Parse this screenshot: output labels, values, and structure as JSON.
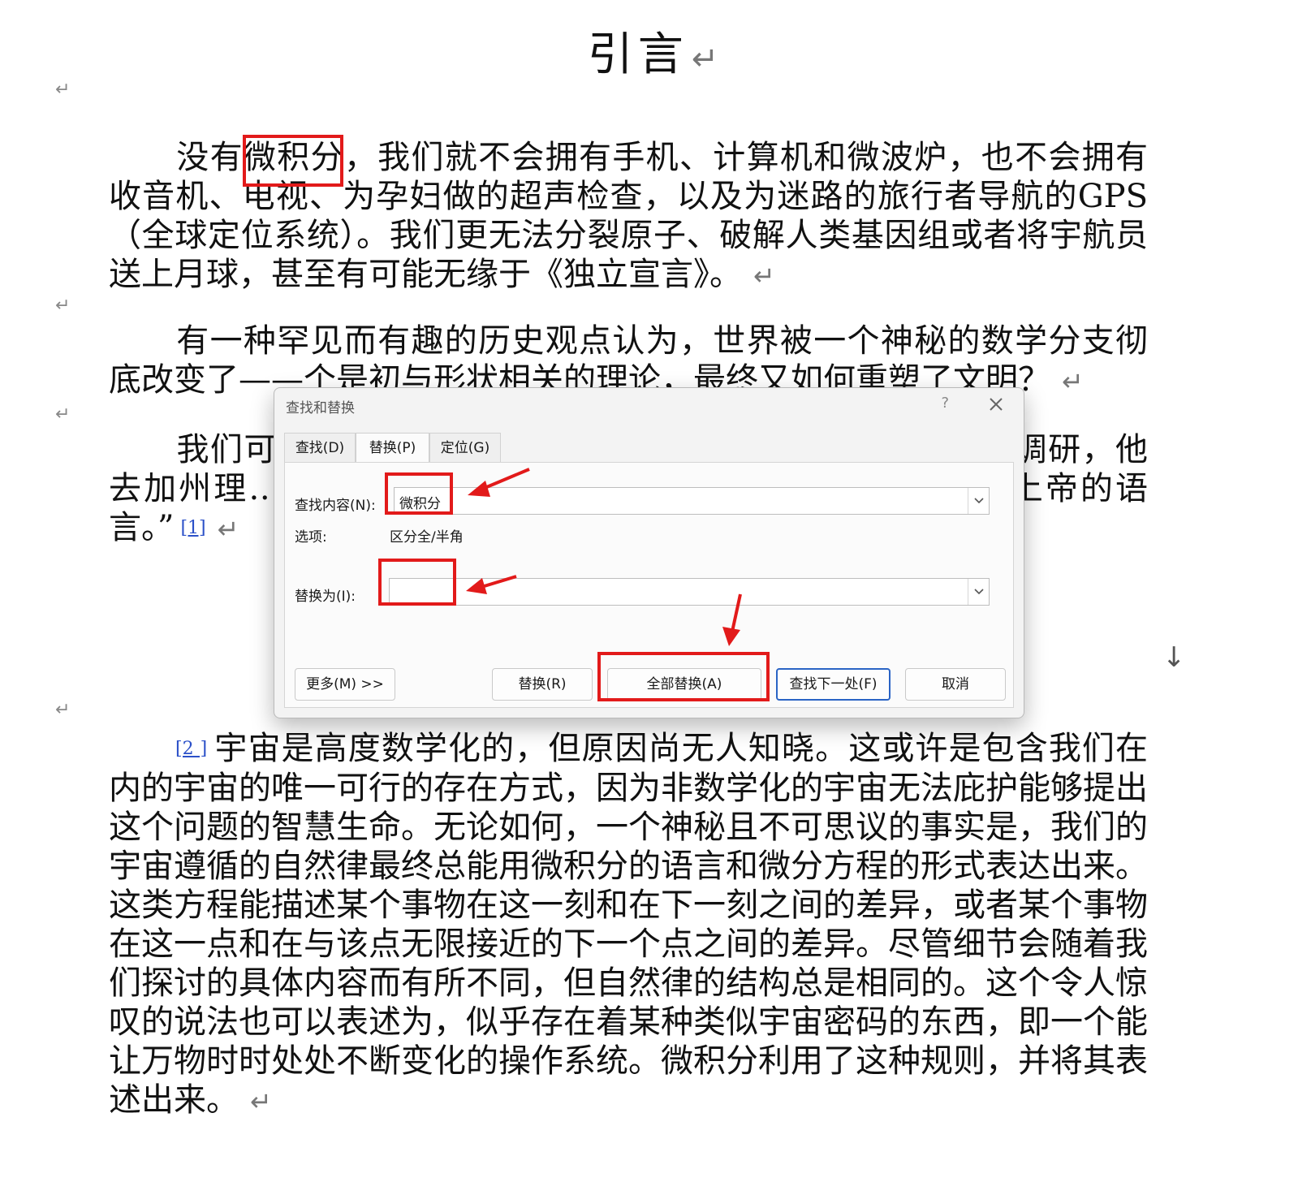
{
  "document": {
    "title": "引言",
    "paragraph_mark": "↵",
    "paragraphs": [
      "没有微积分，我们就不会拥有手机、计算机和微波炉，也不会拥有收音机、电视、为孕妇做的超声检查，以及为迷路的旅行者导航的GPS（全球定位系统）。我们更无法分裂原子、破解人类基因组或者将宇航员送上月球，甚至有可能无缘于《独立宣言》。",
      "有一种罕见而有趣的历史观点认为，世界被一个神秘的数学分支彻底改变了——个是初与形状相关的理论，最终又如何重塑了文明？",
      "我们可……问题的答案，这句……说的。当时沃克正……调研，他去加州理……就是其中之一。采……克坦承他并不了解……上帝的语言。”",
      "宇宙是高度数学化的，但原因尚无人知晓。这或许是包含我们在内的宇宙的唯一可行的存在方式，因为非数学化的宇宙无法庇护能够提出这个问题的智慧生命。无论如何，一个神秘且不可思议的事实是，我们的宇宙遵循的自然律最终总能用微积分的语言和微分方程的形式表达出来。这类方程能描述某个事物在这一刻和在下一刻之间的差异，或者某个事物在这一点和在与该点无限接近的下一个点之间的差异。尽管细节会随着我们探讨的具体内容而有所不同，但自然律的结构总是相同的。这个令人惊叹的说法也可以表述为，似乎存在着某种类似宇宙密码的东西，即一个能让万物时时处处不断变化的操作系统。微积分利用了这种规则，并将其表述出来。"
    ],
    "footnote_1": "[1]",
    "footnote_2": "[2            ]",
    "scroll_glyph": "↓"
  },
  "dialog": {
    "title": "查找和替换",
    "help": "?",
    "tabs": [
      "查找(D)",
      "替换(P)",
      "定位(G)"
    ],
    "active_tab": 1,
    "find_label": "查找内容(N):",
    "find_value": "微积分",
    "options_label": "选项:",
    "options_value": "区分全/半角",
    "replace_label": "替换为(I):",
    "replace_value": "",
    "buttons": {
      "more": "更多(M) >>",
      "replace": "替换(R)",
      "replace_all": "全部替换(A)",
      "find_next": "查找下一处(F)",
      "cancel": "取消"
    }
  },
  "annotation": {
    "color": "#e21a1a"
  }
}
